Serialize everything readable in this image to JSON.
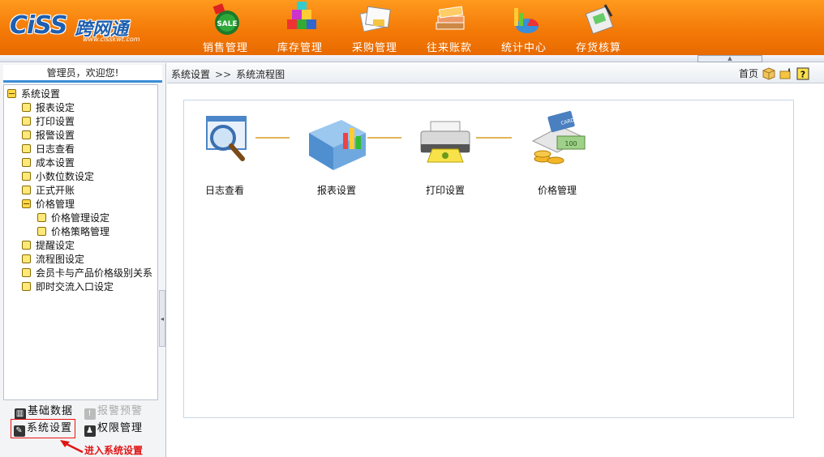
{
  "brand": {
    "logo_text": "CiSS",
    "logo_cn": "跨网通",
    "logo_url": "www.cisskwt.com"
  },
  "nav": [
    {
      "label": "销售管理",
      "icon": "sale-tag-icon"
    },
    {
      "label": "库存管理",
      "icon": "inventory-blocks-icon"
    },
    {
      "label": "采购管理",
      "icon": "purchase-documents-icon"
    },
    {
      "label": "往来账款",
      "icon": "ledger-books-icon"
    },
    {
      "label": "统计中心",
      "icon": "statistics-chart-icon"
    },
    {
      "label": "存货核算",
      "icon": "accounting-pen-icon"
    }
  ],
  "sidebar": {
    "welcome": "管理员，欢迎您!",
    "tree": [
      {
        "label": "系统设置",
        "level": 0,
        "type": "minus"
      },
      {
        "label": "报表设定",
        "level": 1,
        "type": "leaf"
      },
      {
        "label": "打印设置",
        "level": 1,
        "type": "leaf"
      },
      {
        "label": "报警设置",
        "level": 1,
        "type": "leaf"
      },
      {
        "label": "日志查看",
        "level": 1,
        "type": "leaf"
      },
      {
        "label": "成本设置",
        "level": 1,
        "type": "leaf"
      },
      {
        "label": "小数位数设定",
        "level": 1,
        "type": "leaf"
      },
      {
        "label": "正式开账",
        "level": 1,
        "type": "leaf"
      },
      {
        "label": "价格管理",
        "level": 1,
        "type": "minus"
      },
      {
        "label": "价格管理设定",
        "level": 2,
        "type": "leaf"
      },
      {
        "label": "价格策略管理",
        "level": 2,
        "type": "leaf"
      },
      {
        "label": "提醒设定",
        "level": 1,
        "type": "leaf"
      },
      {
        "label": "流程图设定",
        "level": 1,
        "type": "leaf"
      },
      {
        "label": "会员卡与产品价格级别关系",
        "level": 1,
        "type": "leaf"
      },
      {
        "label": "即时交流入口设定",
        "level": 1,
        "type": "leaf"
      }
    ],
    "modules": {
      "basic_data": "基础数据",
      "alarm": "报警预警",
      "system_settings": "系统设置",
      "permissions": "权限管理"
    },
    "annotation": "进入系统设置"
  },
  "breadcrumb": {
    "section": "系统设置",
    "separator": ">>",
    "page": "系统流程图"
  },
  "toolbar": {
    "home": "首页"
  },
  "flow": [
    {
      "label": "日志查看",
      "icon": "magnifier-icon"
    },
    {
      "label": "报表设置",
      "icon": "report-folder-icon"
    },
    {
      "label": "打印设置",
      "icon": "printer-icon"
    },
    {
      "label": "价格管理",
      "icon": "price-money-icon"
    }
  ],
  "colors": {
    "header_orange": "#f47a08",
    "accent_blue": "#3a8ed8",
    "highlight_red": "#e01515",
    "connector": "#e2b45a"
  }
}
